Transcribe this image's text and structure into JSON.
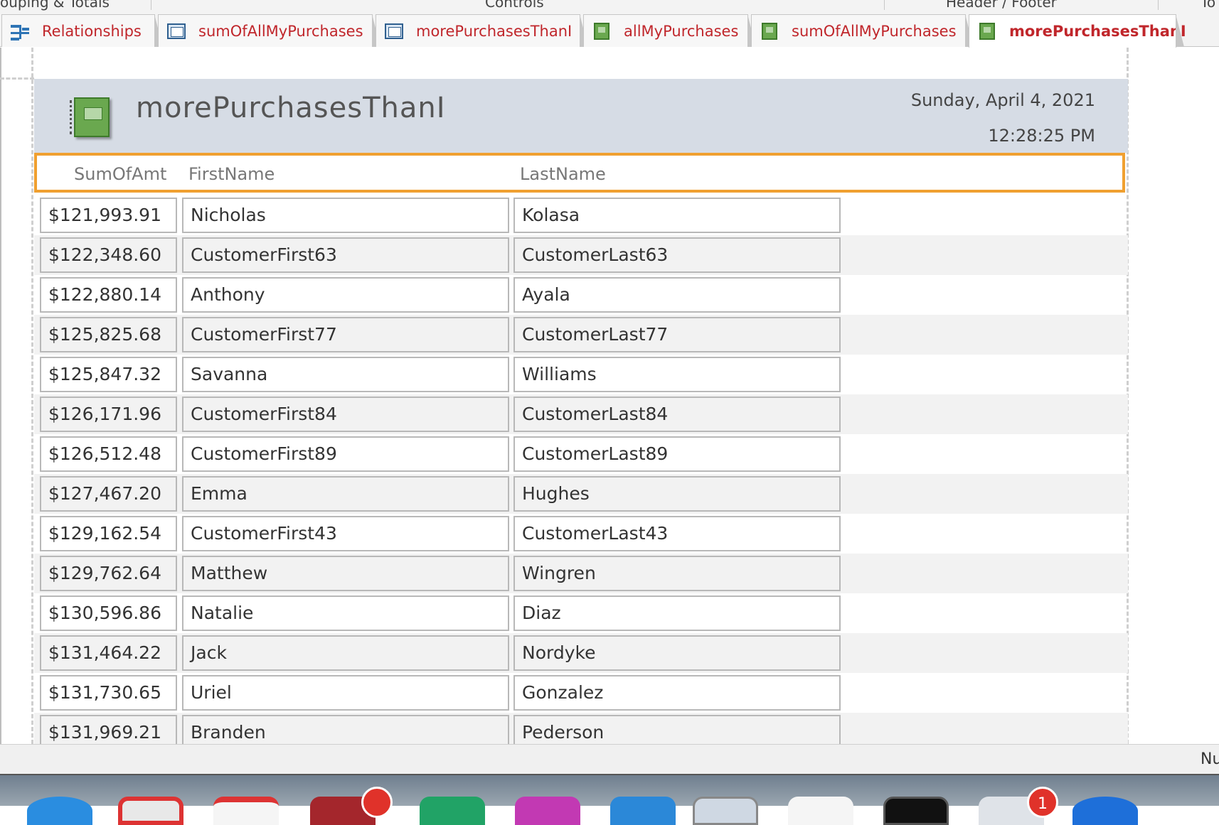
{
  "ribbon": {
    "groups": [
      {
        "label": "ouping & Totals"
      },
      {
        "label": "Controls"
      },
      {
        "label": "Header / Footer"
      },
      {
        "label": "To"
      }
    ]
  },
  "tabs": [
    {
      "label": "Relationships",
      "icon": "relationships-icon",
      "active": false
    },
    {
      "label": "sumOfAllMyPurchases",
      "icon": "query-icon",
      "active": false
    },
    {
      "label": "morePurchasesThanI",
      "icon": "query-icon",
      "active": false
    },
    {
      "label": "allMyPurchases",
      "icon": "report-icon",
      "active": false
    },
    {
      "label": "sumOfAllMyPurchases",
      "icon": "report-icon",
      "active": false
    },
    {
      "label": "morePurchasesThanI",
      "icon": "report-icon",
      "active": true
    }
  ],
  "report": {
    "title": "morePurchasesThanI",
    "date": "Sunday, April 4, 2021",
    "time": "12:28:25 PM",
    "columns": {
      "amount": "SumOfAmt",
      "first": "FirstName",
      "last": "LastName"
    },
    "rows": [
      {
        "amount": "$121,993.91",
        "first": "Nicholas",
        "last": "Kolasa"
      },
      {
        "amount": "$122,348.60",
        "first": "CustomerFirst63",
        "last": "CustomerLast63"
      },
      {
        "amount": "$122,880.14",
        "first": "Anthony",
        "last": "Ayala"
      },
      {
        "amount": "$125,825.68",
        "first": "CustomerFirst77",
        "last": "CustomerLast77"
      },
      {
        "amount": "$125,847.32",
        "first": "Savanna",
        "last": "Williams"
      },
      {
        "amount": "$126,171.96",
        "first": "CustomerFirst84",
        "last": "CustomerLast84"
      },
      {
        "amount": "$126,512.48",
        "first": "CustomerFirst89",
        "last": "CustomerLast89"
      },
      {
        "amount": "$127,467.20",
        "first": "Emma",
        "last": "Hughes"
      },
      {
        "amount": "$129,162.54",
        "first": "CustomerFirst43",
        "last": "CustomerLast43"
      },
      {
        "amount": "$129,762.64",
        "first": "Matthew",
        "last": "Wingren"
      },
      {
        "amount": "$130,596.86",
        "first": "Natalie",
        "last": "Diaz"
      },
      {
        "amount": "$131,464.22",
        "first": "Jack",
        "last": "Nordyke"
      },
      {
        "amount": "$131,730.65",
        "first": "Uriel",
        "last": "Gonzalez"
      },
      {
        "amount": "$131,969.21",
        "first": "Branden",
        "last": "Pederson"
      }
    ]
  },
  "status": {
    "text": "Nu"
  },
  "taskbar": {
    "badges": [
      "1"
    ],
    "apps": [
      "app-icon-1",
      "app-icon-2",
      "app-icon-3",
      "app-icon-4",
      "app-icon-5",
      "app-icon-6",
      "app-icon-7",
      "app-icon-8",
      "app-icon-9",
      "app-icon-10",
      "app-icon-11",
      "app-icon-12"
    ]
  },
  "colors": {
    "accent": "#c0262b",
    "highlight": "#f0a030",
    "header_bg": "#d6dce5"
  }
}
